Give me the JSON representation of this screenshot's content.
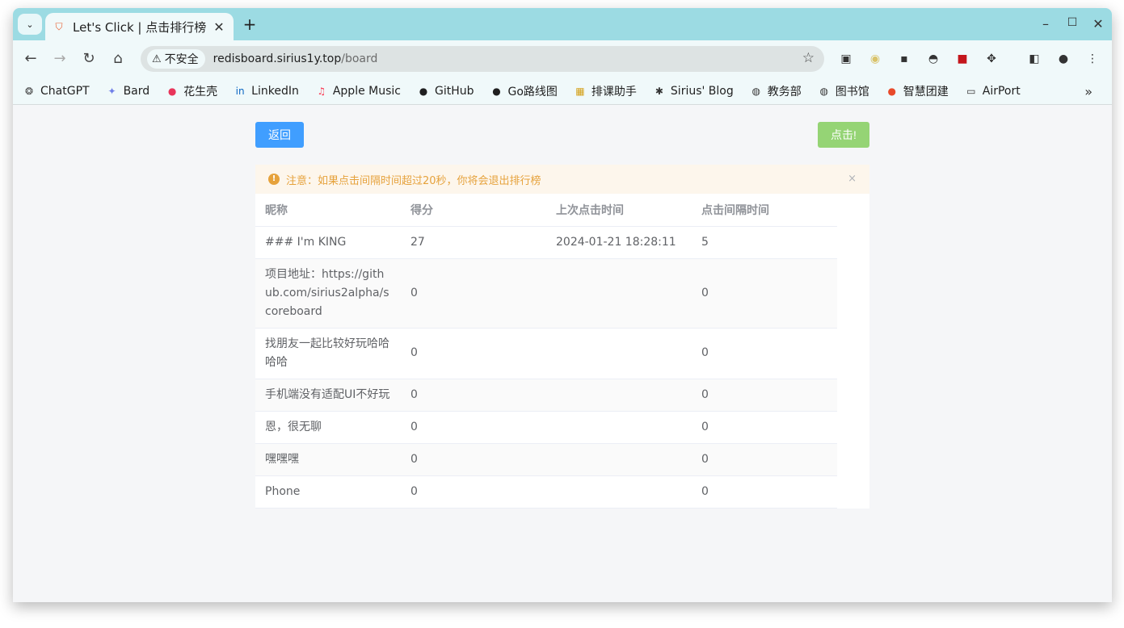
{
  "browser": {
    "tab": {
      "title": "Let's Click | 点击排行榜",
      "close": "✕"
    },
    "new_tab": "+",
    "window_controls": {
      "minimize": "–",
      "maximize": "☐",
      "close": "✕"
    },
    "security_label": "不安全",
    "url_host": "redisboard.sirius1y.top",
    "url_path": "/board"
  },
  "bookmarks": [
    {
      "label": "ChatGPT",
      "icon": "chatgpt-icon",
      "glyph": "❂",
      "color": "#444444"
    },
    {
      "label": "Bard",
      "icon": "bard-icon",
      "glyph": "✦",
      "color": "#6f7fe8"
    },
    {
      "label": "花生壳",
      "icon": "huashengke-icon",
      "glyph": "●",
      "color": "#e8355a"
    },
    {
      "label": "LinkedIn",
      "icon": "linkedin-icon",
      "glyph": "in",
      "color": "#0a66c2"
    },
    {
      "label": "Apple Music",
      "icon": "apple-music-icon",
      "glyph": "♫",
      "color": "#fa3c55"
    },
    {
      "label": "GitHub",
      "icon": "github-icon",
      "glyph": "●",
      "color": "#1f1f1f"
    },
    {
      "label": "Go路线图",
      "icon": "github-icon",
      "glyph": "●",
      "color": "#1f1f1f"
    },
    {
      "label": "排课助手",
      "icon": "schedule-icon",
      "glyph": "▦",
      "color": "#d4a017"
    },
    {
      "label": "Sirius' Blog",
      "icon": "blog-icon",
      "glyph": "✱",
      "color": "#333333"
    },
    {
      "label": "教务部",
      "icon": "globe-icon",
      "glyph": "◍",
      "color": "#333333"
    },
    {
      "label": "图书馆",
      "icon": "globe-icon",
      "glyph": "◍",
      "color": "#333333"
    },
    {
      "label": "智慧团建",
      "icon": "youth-league-icon",
      "glyph": "●",
      "color": "#e84a2a"
    },
    {
      "label": "AirPort",
      "icon": "folder-icon",
      "glyph": "▭",
      "color": "#333333"
    }
  ],
  "page": {
    "back_button": "返回",
    "click_button": "点击!",
    "alert": "注意：如果点击间隔时间超过20秒，你将会退出排行榜",
    "alert_close": "×",
    "table": {
      "headers": [
        "昵称",
        "得分",
        "上次点击时间",
        "点击间隔时间"
      ],
      "rows": [
        [
          "### I'm KING",
          "27",
          "2024-01-21 18:28:11",
          "5"
        ],
        [
          "项目地址：https://github.com/sirius2alpha/scoreboard",
          "0",
          "",
          "0"
        ],
        [
          "找朋友一起比较好玩哈哈哈哈",
          "0",
          "",
          "0"
        ],
        [
          "手机端没有适配UI不好玩",
          "0",
          "",
          "0"
        ],
        [
          "恩，很无聊",
          "0",
          "",
          "0"
        ],
        [
          "嘿嘿嘿",
          "0",
          "",
          "0"
        ],
        [
          "Phone",
          "0",
          "",
          "0"
        ]
      ]
    }
  },
  "colors": {
    "tabstrip": "#9cdbe3",
    "primary": "#409eff",
    "success_light": "#95d475",
    "warning": "#e6a23c"
  }
}
